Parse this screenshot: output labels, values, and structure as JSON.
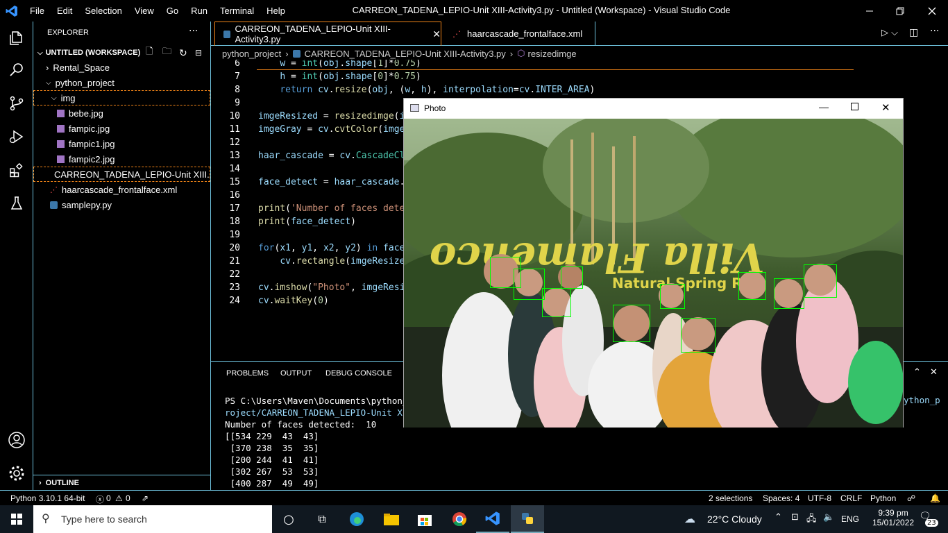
{
  "titlebar": {
    "menu": [
      "File",
      "Edit",
      "Selection",
      "View",
      "Go",
      "Run",
      "Terminal",
      "Help"
    ],
    "title": "CARREON_TADENA_LEPIO-Unit XIII-Activity3.py - Untitled (Workspace) - Visual Studio Code"
  },
  "sidebar": {
    "header": "EXPLORER",
    "workspace": "UNTITLED (WORKSPACE)",
    "items": [
      {
        "label": "Rental_Space"
      },
      {
        "label": "python_project"
      },
      {
        "label": "img"
      },
      {
        "label": "bebe.jpg"
      },
      {
        "label": "fampic.jpg"
      },
      {
        "label": "fampic1.jpg"
      },
      {
        "label": "fampic2.jpg"
      },
      {
        "label": "CARREON_TADENA_LEPIO-Unit XIII..."
      },
      {
        "label": "haarcascade_frontalface.xml"
      },
      {
        "label": "samplepy.py"
      }
    ],
    "outline": "OUTLINE"
  },
  "tabs": [
    {
      "label": "CARREON_TADENA_LEPIO-Unit XIII-Activity3.py"
    },
    {
      "label": "haarcascade_frontalface.xml"
    }
  ],
  "breadcrumb": {
    "folder": "python_project",
    "file": "CARREON_TADENA_LEPIO-Unit XIII-Activity3.py",
    "symbol": "resizedimge"
  },
  "code": {
    "line_numbers": [
      "6",
      "7",
      "8",
      "9",
      "10",
      "11",
      "12",
      "13",
      "14",
      "15",
      "16",
      "17",
      "18",
      "19",
      "20",
      "21",
      "22",
      "23",
      "24"
    ]
  },
  "panel": {
    "tabs": [
      "PROBLEMS",
      "OUTPUT",
      "DEBUG CONSOLE"
    ],
    "terminal": [
      "PS C:\\Users\\Maven\\Documents\\python_pr",
      "roject/CARREON_TADENA_LEPIO-Unit XIII",
      "Number of faces detected:  10",
      "[[534 229  43  43]",
      " [370 238  35  35]",
      " [200 244  41  41]",
      " [302 267  53  53]",
      " [400 287  49  49]"
    ],
    "terminal_right": "ython_p"
  },
  "photo_window": {
    "title": "Photo",
    "sign_text": "Villa Flamenco",
    "sign_sub": "Natural Spring Re"
  },
  "statusbar": {
    "python": "Python 3.10.1 64-bit",
    "errors": "0",
    "warnings": "0",
    "selections": "2 selections",
    "spaces": "Spaces: 4",
    "encoding": "UTF-8",
    "eol": "CRLF",
    "language": "Python"
  },
  "taskbar": {
    "search_placeholder": "Type here to search",
    "weather": "22°C  Cloudy",
    "lang": "ENG",
    "time": "9:39 pm",
    "date": "15/01/2022",
    "notifications": "23"
  }
}
